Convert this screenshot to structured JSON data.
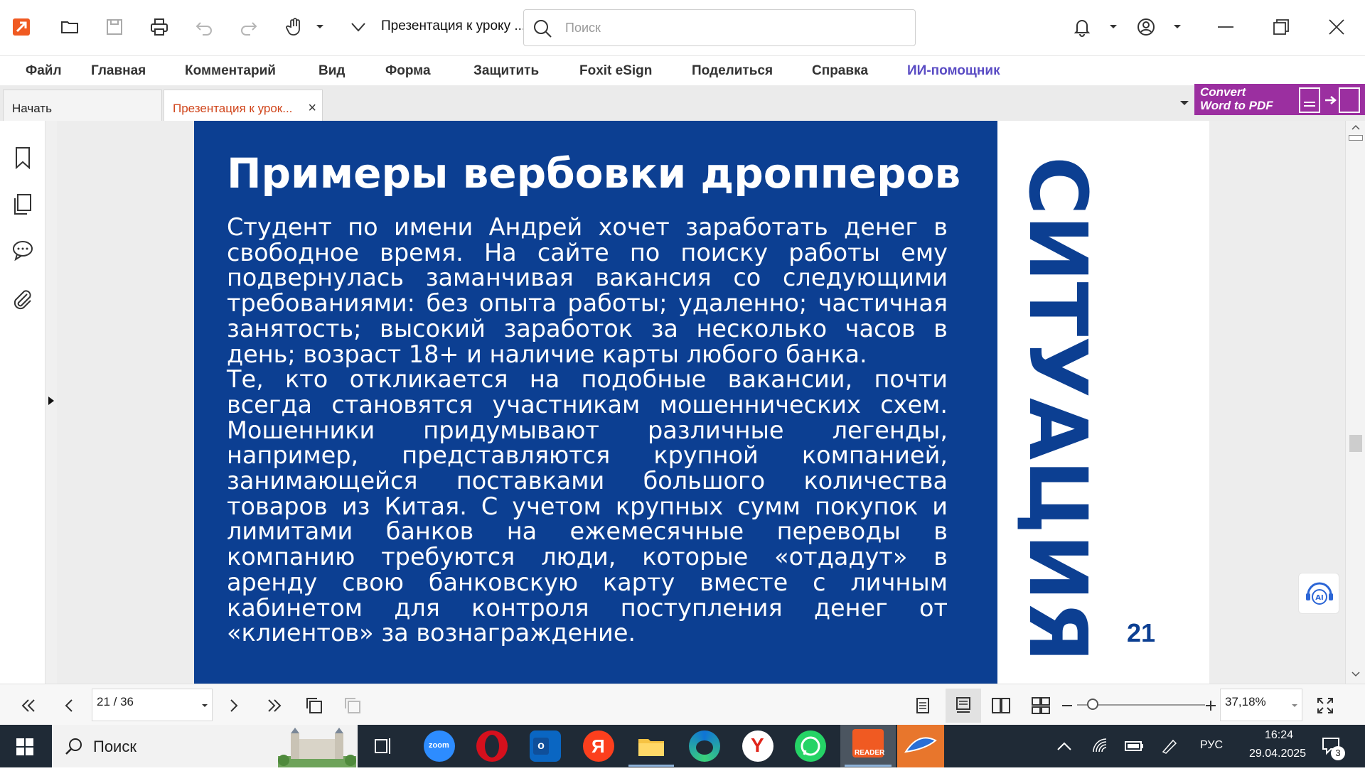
{
  "titlebar": {
    "doc_title": "Презентация к уроку ...",
    "search_placeholder": "Поиск"
  },
  "menu": {
    "items": [
      "Файл",
      "Главная",
      "Комментарий",
      "Вид",
      "Форма",
      "Защитить",
      "Foxit eSign",
      "Поделиться",
      "Справка",
      "ИИ-помощник"
    ]
  },
  "tabs": {
    "start": "Начать",
    "active": "Презентация к урок..."
  },
  "convert_banner": {
    "line1": "Convert",
    "line2": "Word to PDF"
  },
  "slide": {
    "title": "Примеры вербовки дропперов",
    "paragraph1": "Студент по имени Андрей хочет заработать денег в свободное время. На сайте по поиску работы ему подвернулась заманчивая вакансия со следующими требованиями: без опыта работы; удаленно; частичная занятость; высокий заработок за несколько часов в день; возраст 18+ и наличие карты любого банка.",
    "paragraph2": "Те, кто откликается на подобные вакансии, почти всегда становятся участникам мошеннических схем. Мошенники придумывают различные легенды, например, представляются крупной компанией, занимающейся поставками большого количества товаров из Китая. С учетом крупных сумм покупок и лимитами банков на ежемесячные переводы в компанию требуются люди, которые «отдадут» в аренду свою банковскую карту вместе с личным кабинетом для контроля поступления денег от «клиентов» за вознаграждение.",
    "vertical_word": "СИТУАЦИЯ",
    "page_number": "21",
    "blue": "#0c3f92"
  },
  "statusbar": {
    "page": "21 / 36",
    "zoom": "37,18%",
    "zoom_level": 0.12
  },
  "taskbar": {
    "search_label": "Поиск",
    "lang": "РУС",
    "time": "16:24",
    "date": "29.04.2025",
    "notifications": "3",
    "zoom_app": "zoom",
    "reader_app": "READER"
  },
  "colors": {
    "accent": "#d0451b",
    "ai": "#5a4cc4",
    "taskbar": "#1f2a36"
  }
}
